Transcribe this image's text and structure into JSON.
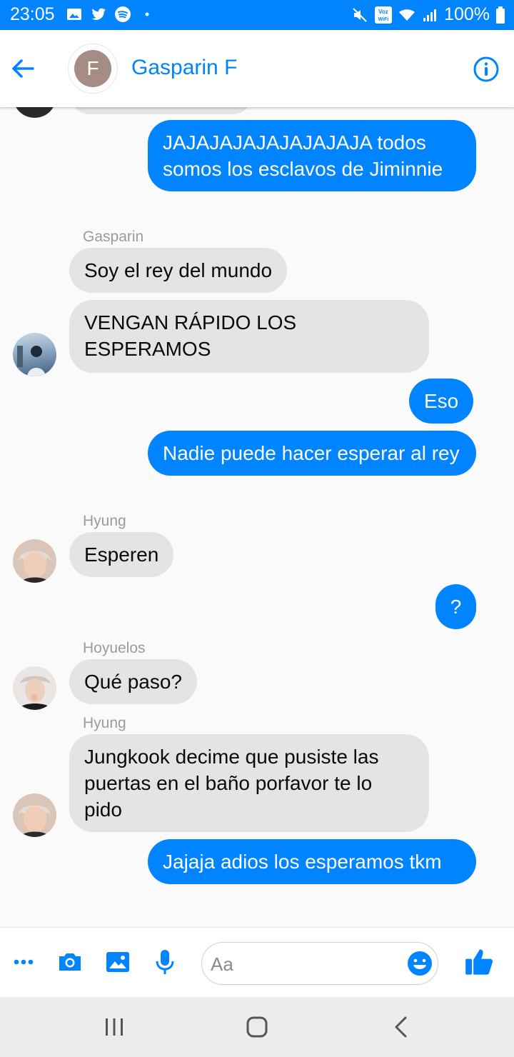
{
  "status_bar": {
    "time": "23:05",
    "battery": "100%",
    "icons_left": [
      "gallery-icon",
      "twitter-icon",
      "spotify-icon",
      "dot-icon"
    ],
    "icons_right": [
      "mute-icon",
      "volte-icon",
      "wifi-icon",
      "signal-icon",
      "battery-icon"
    ],
    "volte_label": "Voz WiFi"
  },
  "header": {
    "avatar_letter": "F",
    "title": "Gasparin F",
    "accent": "#0084ff"
  },
  "messages": [
    {
      "dir": "out",
      "text": "JAJAJAJAJAJAJAJAJA todos somos los esclavos de Jiminnie"
    },
    {
      "sender": "Gasparin"
    },
    {
      "dir": "in",
      "text": "Soy el rey del mundo"
    },
    {
      "dir": "in",
      "text": "VENGAN RÁPIDO LOS ESPERAMOS"
    },
    {
      "dir": "out",
      "text": "Eso"
    },
    {
      "dir": "out",
      "text": "Nadie puede hacer esperar al rey"
    },
    {
      "sender": "Hyung"
    },
    {
      "dir": "in",
      "text": "Esperen"
    },
    {
      "dir": "out",
      "text": "?"
    },
    {
      "sender": "Hoyuelos"
    },
    {
      "dir": "in",
      "text": "Qué paso?"
    },
    {
      "sender": "Hyung"
    },
    {
      "dir": "in",
      "text": "Jungkook decime que pusiste las puertas en el baño porfavor te lo pido"
    },
    {
      "dir": "out",
      "text": "Jajaja adios los esperamos tkm"
    }
  ],
  "composer": {
    "placeholder": "Aa"
  }
}
